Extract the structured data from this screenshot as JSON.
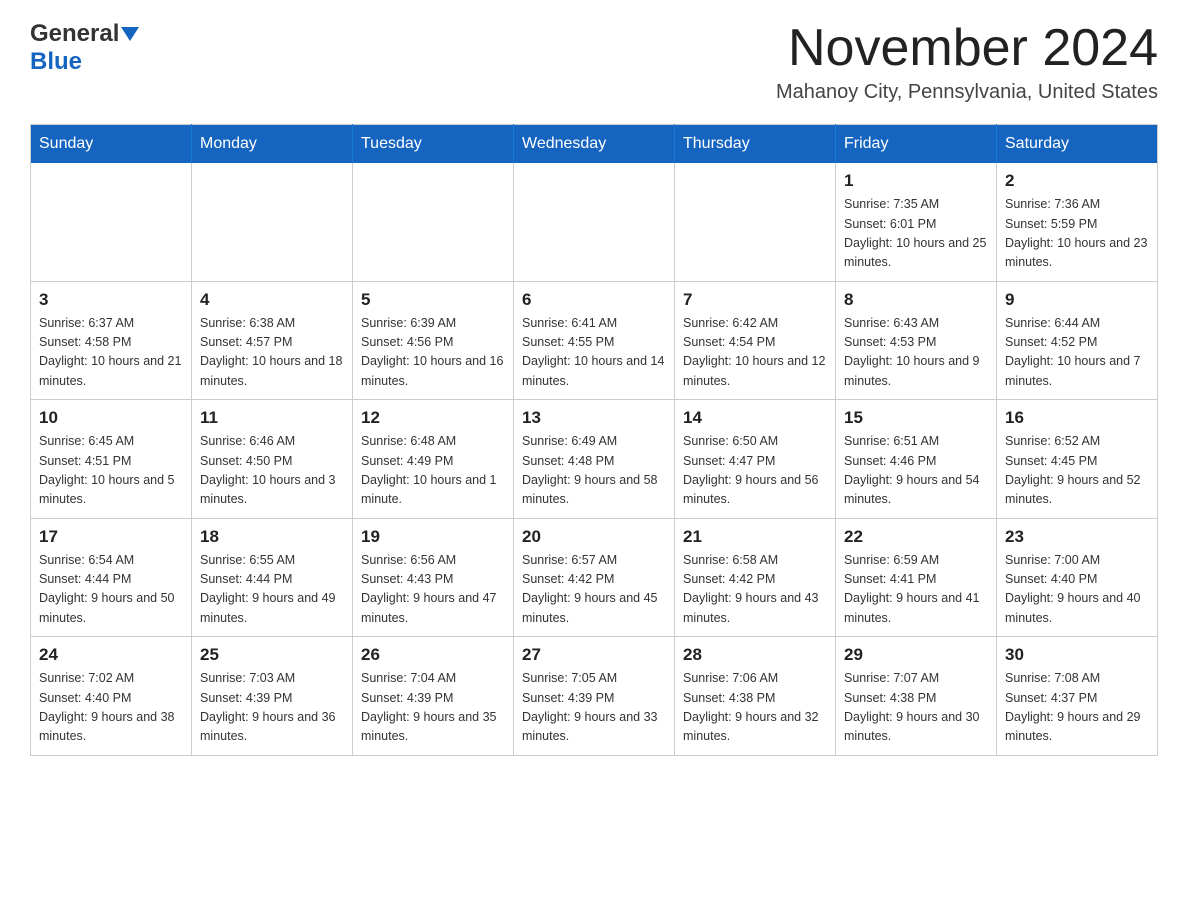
{
  "header": {
    "logo_general": "General",
    "logo_blue": "Blue",
    "month_title": "November 2024",
    "location": "Mahanoy City, Pennsylvania, United States"
  },
  "weekdays": [
    "Sunday",
    "Monday",
    "Tuesday",
    "Wednesday",
    "Thursday",
    "Friday",
    "Saturday"
  ],
  "weeks": [
    [
      {
        "day": "",
        "sunrise": "",
        "sunset": "",
        "daylight": ""
      },
      {
        "day": "",
        "sunrise": "",
        "sunset": "",
        "daylight": ""
      },
      {
        "day": "",
        "sunrise": "",
        "sunset": "",
        "daylight": ""
      },
      {
        "day": "",
        "sunrise": "",
        "sunset": "",
        "daylight": ""
      },
      {
        "day": "",
        "sunrise": "",
        "sunset": "",
        "daylight": ""
      },
      {
        "day": "1",
        "sunrise": "Sunrise: 7:35 AM",
        "sunset": "Sunset: 6:01 PM",
        "daylight": "Daylight: 10 hours and 25 minutes."
      },
      {
        "day": "2",
        "sunrise": "Sunrise: 7:36 AM",
        "sunset": "Sunset: 5:59 PM",
        "daylight": "Daylight: 10 hours and 23 minutes."
      }
    ],
    [
      {
        "day": "3",
        "sunrise": "Sunrise: 6:37 AM",
        "sunset": "Sunset: 4:58 PM",
        "daylight": "Daylight: 10 hours and 21 minutes."
      },
      {
        "day": "4",
        "sunrise": "Sunrise: 6:38 AM",
        "sunset": "Sunset: 4:57 PM",
        "daylight": "Daylight: 10 hours and 18 minutes."
      },
      {
        "day": "5",
        "sunrise": "Sunrise: 6:39 AM",
        "sunset": "Sunset: 4:56 PM",
        "daylight": "Daylight: 10 hours and 16 minutes."
      },
      {
        "day": "6",
        "sunrise": "Sunrise: 6:41 AM",
        "sunset": "Sunset: 4:55 PM",
        "daylight": "Daylight: 10 hours and 14 minutes."
      },
      {
        "day": "7",
        "sunrise": "Sunrise: 6:42 AM",
        "sunset": "Sunset: 4:54 PM",
        "daylight": "Daylight: 10 hours and 12 minutes."
      },
      {
        "day": "8",
        "sunrise": "Sunrise: 6:43 AM",
        "sunset": "Sunset: 4:53 PM",
        "daylight": "Daylight: 10 hours and 9 minutes."
      },
      {
        "day": "9",
        "sunrise": "Sunrise: 6:44 AM",
        "sunset": "Sunset: 4:52 PM",
        "daylight": "Daylight: 10 hours and 7 minutes."
      }
    ],
    [
      {
        "day": "10",
        "sunrise": "Sunrise: 6:45 AM",
        "sunset": "Sunset: 4:51 PM",
        "daylight": "Daylight: 10 hours and 5 minutes."
      },
      {
        "day": "11",
        "sunrise": "Sunrise: 6:46 AM",
        "sunset": "Sunset: 4:50 PM",
        "daylight": "Daylight: 10 hours and 3 minutes."
      },
      {
        "day": "12",
        "sunrise": "Sunrise: 6:48 AM",
        "sunset": "Sunset: 4:49 PM",
        "daylight": "Daylight: 10 hours and 1 minute."
      },
      {
        "day": "13",
        "sunrise": "Sunrise: 6:49 AM",
        "sunset": "Sunset: 4:48 PM",
        "daylight": "Daylight: 9 hours and 58 minutes."
      },
      {
        "day": "14",
        "sunrise": "Sunrise: 6:50 AM",
        "sunset": "Sunset: 4:47 PM",
        "daylight": "Daylight: 9 hours and 56 minutes."
      },
      {
        "day": "15",
        "sunrise": "Sunrise: 6:51 AM",
        "sunset": "Sunset: 4:46 PM",
        "daylight": "Daylight: 9 hours and 54 minutes."
      },
      {
        "day": "16",
        "sunrise": "Sunrise: 6:52 AM",
        "sunset": "Sunset: 4:45 PM",
        "daylight": "Daylight: 9 hours and 52 minutes."
      }
    ],
    [
      {
        "day": "17",
        "sunrise": "Sunrise: 6:54 AM",
        "sunset": "Sunset: 4:44 PM",
        "daylight": "Daylight: 9 hours and 50 minutes."
      },
      {
        "day": "18",
        "sunrise": "Sunrise: 6:55 AM",
        "sunset": "Sunset: 4:44 PM",
        "daylight": "Daylight: 9 hours and 49 minutes."
      },
      {
        "day": "19",
        "sunrise": "Sunrise: 6:56 AM",
        "sunset": "Sunset: 4:43 PM",
        "daylight": "Daylight: 9 hours and 47 minutes."
      },
      {
        "day": "20",
        "sunrise": "Sunrise: 6:57 AM",
        "sunset": "Sunset: 4:42 PM",
        "daylight": "Daylight: 9 hours and 45 minutes."
      },
      {
        "day": "21",
        "sunrise": "Sunrise: 6:58 AM",
        "sunset": "Sunset: 4:42 PM",
        "daylight": "Daylight: 9 hours and 43 minutes."
      },
      {
        "day": "22",
        "sunrise": "Sunrise: 6:59 AM",
        "sunset": "Sunset: 4:41 PM",
        "daylight": "Daylight: 9 hours and 41 minutes."
      },
      {
        "day": "23",
        "sunrise": "Sunrise: 7:00 AM",
        "sunset": "Sunset: 4:40 PM",
        "daylight": "Daylight: 9 hours and 40 minutes."
      }
    ],
    [
      {
        "day": "24",
        "sunrise": "Sunrise: 7:02 AM",
        "sunset": "Sunset: 4:40 PM",
        "daylight": "Daylight: 9 hours and 38 minutes."
      },
      {
        "day": "25",
        "sunrise": "Sunrise: 7:03 AM",
        "sunset": "Sunset: 4:39 PM",
        "daylight": "Daylight: 9 hours and 36 minutes."
      },
      {
        "day": "26",
        "sunrise": "Sunrise: 7:04 AM",
        "sunset": "Sunset: 4:39 PM",
        "daylight": "Daylight: 9 hours and 35 minutes."
      },
      {
        "day": "27",
        "sunrise": "Sunrise: 7:05 AM",
        "sunset": "Sunset: 4:39 PM",
        "daylight": "Daylight: 9 hours and 33 minutes."
      },
      {
        "day": "28",
        "sunrise": "Sunrise: 7:06 AM",
        "sunset": "Sunset: 4:38 PM",
        "daylight": "Daylight: 9 hours and 32 minutes."
      },
      {
        "day": "29",
        "sunrise": "Sunrise: 7:07 AM",
        "sunset": "Sunset: 4:38 PM",
        "daylight": "Daylight: 9 hours and 30 minutes."
      },
      {
        "day": "30",
        "sunrise": "Sunrise: 7:08 AM",
        "sunset": "Sunset: 4:37 PM",
        "daylight": "Daylight: 9 hours and 29 minutes."
      }
    ]
  ]
}
